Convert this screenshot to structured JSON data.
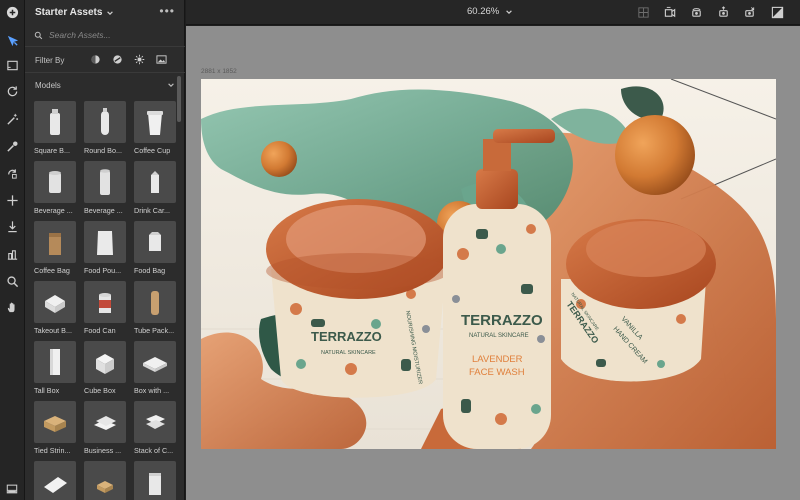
{
  "toolbar_left": {
    "tools": [
      {
        "name": "select-tool",
        "icon": "move-arrow-icon"
      },
      {
        "name": "frame-tool",
        "icon": "frame-icon"
      },
      {
        "name": "orbit-tool",
        "icon": "orbit-icon"
      },
      {
        "name": "magic-select-tool",
        "icon": "magic-wand-icon"
      },
      {
        "name": "sample-tool",
        "icon": "eyedropper-icon"
      },
      {
        "name": "rotate-tool",
        "icon": "rotate-icon"
      },
      {
        "name": "pan-tool",
        "icon": "plus-move-icon"
      },
      {
        "name": "drop-tool",
        "icon": "drop-to-ground-icon"
      },
      {
        "name": "align-tool",
        "icon": "align-icon"
      },
      {
        "name": "zoom-tool",
        "icon": "zoom-icon"
      },
      {
        "name": "hand-tool",
        "icon": "hand-icon"
      }
    ]
  },
  "assets_panel": {
    "title": "Starter Assets",
    "search_placeholder": "Search Assets...",
    "filter_label": "Filter By",
    "section_label": "Models",
    "items": [
      {
        "label": "Square B...",
        "shape": "bottle-square"
      },
      {
        "label": "Round Bo...",
        "shape": "bottle-round"
      },
      {
        "label": "Coffee Cup",
        "shape": "cup"
      },
      {
        "label": "Beverage ...",
        "shape": "can"
      },
      {
        "label": "Beverage ...",
        "shape": "can-tall"
      },
      {
        "label": "Drink Car...",
        "shape": "carton"
      },
      {
        "label": "Coffee Bag",
        "shape": "coffee-bag"
      },
      {
        "label": "Food Pou...",
        "shape": "pouch"
      },
      {
        "label": "Food Bag",
        "shape": "food-bag"
      },
      {
        "label": "Takeout B...",
        "shape": "takeout"
      },
      {
        "label": "Food Can",
        "shape": "food-can"
      },
      {
        "label": "Tube Pack...",
        "shape": "tube"
      },
      {
        "label": "Tall Box",
        "shape": "tall-box"
      },
      {
        "label": "Cube Box",
        "shape": "cube-box"
      },
      {
        "label": "Box with ...",
        "shape": "flat-box"
      },
      {
        "label": "Tied Strin...",
        "shape": "tied-box"
      },
      {
        "label": "Business ...",
        "shape": "cards"
      },
      {
        "label": "Stack of C...",
        "shape": "stack"
      },
      {
        "label": "",
        "shape": "paper"
      },
      {
        "label": "",
        "shape": "small-box"
      },
      {
        "label": "",
        "shape": "bag"
      }
    ]
  },
  "topbar": {
    "zoom_value": "60.26%"
  },
  "canvas": {
    "document_size": "2881 x 1852",
    "products": {
      "jar_left": {
        "brand": "TERRAZZO",
        "subtitle": "NATURAL SKINCARE",
        "product": "NOURISHING MOISTURIZER"
      },
      "bottle": {
        "brand": "TERRAZZO",
        "subtitle": "NATURAL SKINCARE",
        "product_line1": "LAVENDER",
        "product_line2": "FACE WASH"
      },
      "jar_right": {
        "brand": "TERRAZZO",
        "subtitle": "NATURAL SKINCARE",
        "product_line1": "VANILLA",
        "product_line2": "HAND CREAM"
      }
    }
  },
  "colors": {
    "accent": "#5aa0ff",
    "orange": "#c8662e",
    "teal": "#6aa58d",
    "label_cream": "#efe2cc"
  }
}
